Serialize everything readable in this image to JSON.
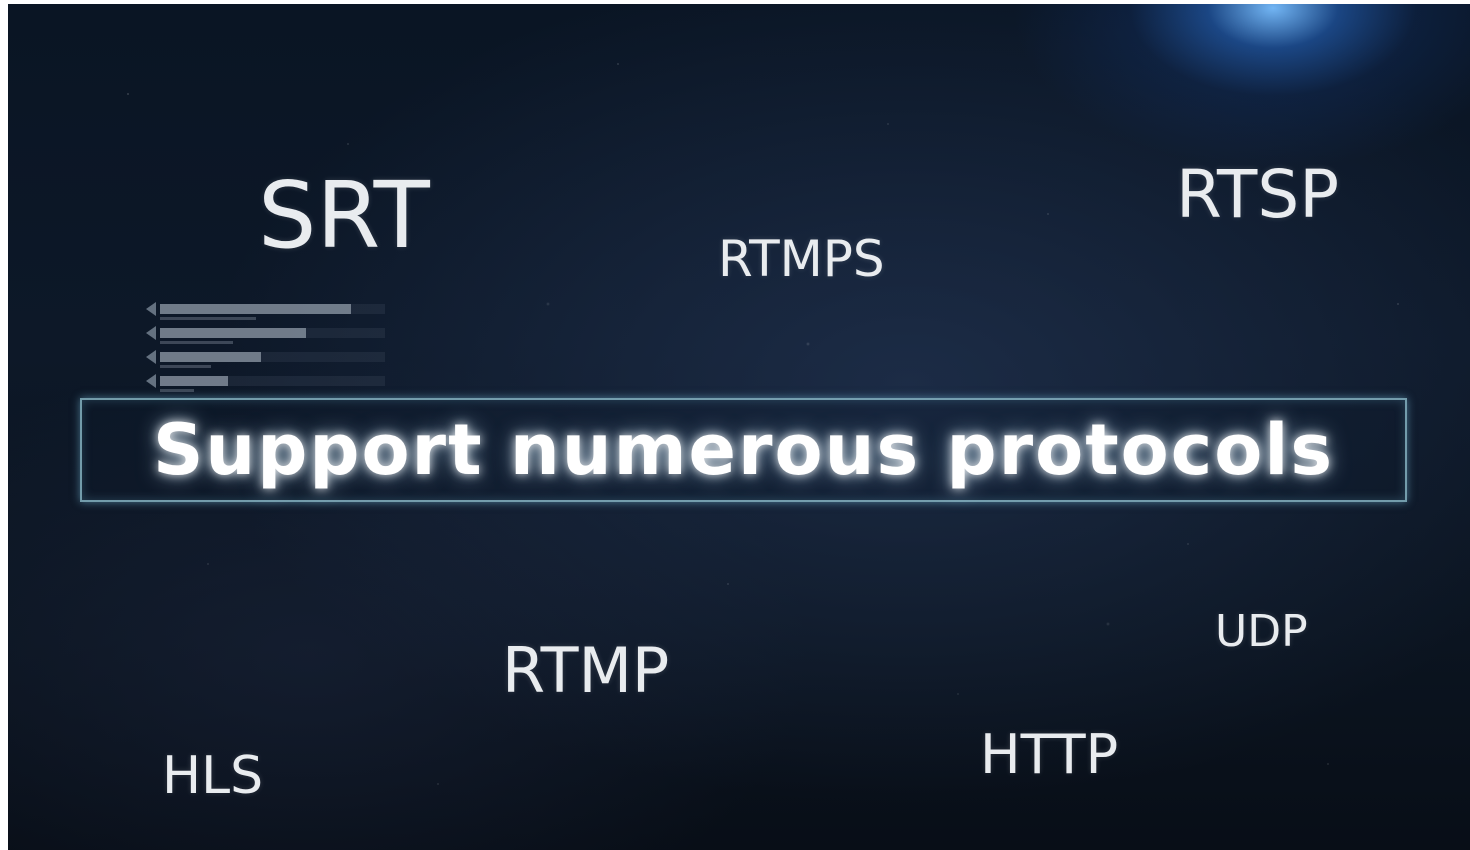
{
  "scene": {
    "background": "dark starry space backdrop",
    "glow_color": "#5aa8ff"
  },
  "protocols": {
    "srt": "SRT",
    "rtmps": "RTMPS",
    "rtsp": "RTSP",
    "rtmp": "RTMP",
    "udp": "UDP",
    "http": "HTTP",
    "hls": "HLS"
  },
  "banner": {
    "title": "Support numerous protocols",
    "border_color": "#96c8d7"
  },
  "hud_graphic": {
    "bars": [
      {
        "fill": 0.85
      },
      {
        "fill": 0.65
      },
      {
        "fill": 0.45
      },
      {
        "fill": 0.3
      }
    ]
  }
}
